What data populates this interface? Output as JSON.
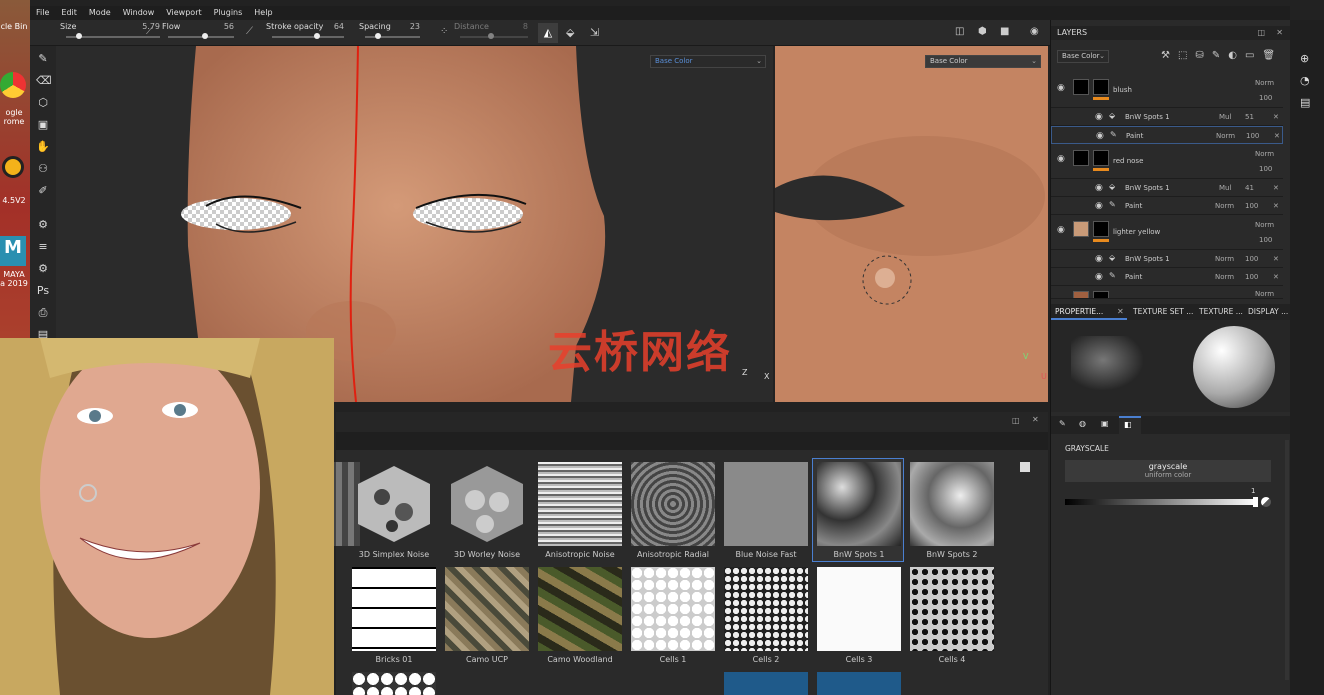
{
  "menu": [
    "File",
    "Edit",
    "Mode",
    "Window",
    "Viewport",
    "Plugins",
    "Help"
  ],
  "toolbar": {
    "size": {
      "label": "Size",
      "value": "5.79"
    },
    "flow": {
      "label": "Flow",
      "value": "56"
    },
    "stroke_opacity": {
      "label": "Stroke opacity",
      "value": "64"
    },
    "spacing": {
      "label": "Spacing",
      "value": "23"
    },
    "distance": {
      "label": "Distance",
      "value": "8"
    }
  },
  "viewport3d": {
    "channel": "Base Color"
  },
  "viewport2d": {
    "channel": "Base Color",
    "axis_v": "V",
    "axis_u": "U"
  },
  "viewport3d_axes": {
    "y": "Y",
    "z": "Z",
    "x": "X"
  },
  "desktop_icons": [
    "cle Bin",
    "ogle",
    "rome",
    "4.5V2",
    "MAYA",
    "a 2019"
  ],
  "layers": {
    "title": "LAYERS",
    "channel": "Base Color",
    "items": [
      {
        "name": "blush",
        "blend": "Norm",
        "opacity": "100",
        "thumb_color": "#000000",
        "accent": "#e88a1e",
        "subs": [
          {
            "name": "BnW Spots 1",
            "blend": "Mul",
            "opacity": "51"
          },
          {
            "name": "Paint",
            "blend": "Norm",
            "opacity": "100"
          }
        ]
      },
      {
        "name": "red nose",
        "blend": "Norm",
        "opacity": "100",
        "thumb_color": "#000000",
        "accent": "#e88a1e",
        "subs": [
          {
            "name": "BnW Spots 1",
            "blend": "Mul",
            "opacity": "41"
          },
          {
            "name": "Paint",
            "blend": "Norm",
            "opacity": "100"
          }
        ]
      },
      {
        "name": "lighter yellow",
        "blend": "Norm",
        "opacity": "100",
        "thumb_color": "#c89a78",
        "accent": "#e88a1e",
        "subs": [
          {
            "name": "BnW Spots 1",
            "blend": "Norm",
            "opacity": "100"
          },
          {
            "name": "Paint",
            "blend": "Norm",
            "opacity": "100"
          }
        ]
      },
      {
        "name": "",
        "blend": "Norm",
        "opacity": "",
        "thumb_color": "#a06040",
        "accent": "#e88a1e",
        "subs": []
      }
    ]
  },
  "properties_tabs": [
    "PROPERTIE...",
    "TEXTURE SET ...",
    "TEXTURE ...",
    "DISPLAY ..."
  ],
  "properties": {
    "section": "GRAYSCALE",
    "input_name": "grayscale",
    "input_sub": "uniform color",
    "value": "1"
  },
  "shelf": {
    "row1": [
      "al",
      "3D Simplex Noise",
      "3D Worley Noise",
      "Anisotropic Noise",
      "Anisotropic Radial",
      "Blue Noise Fast",
      "BnW Spots 1",
      "BnW Spots 2"
    ],
    "row2": [
      "Bricks 01",
      "Camo UCP",
      "Camo Woodland",
      "Cells 1",
      "Cells 2",
      "Cells 3",
      "Cells 4"
    ]
  },
  "watermark": "云桥网络",
  "colors": {
    "accent": "#e88a1e",
    "selected": "#4a7fd0",
    "layer_highlight": "#3a5a8a"
  }
}
